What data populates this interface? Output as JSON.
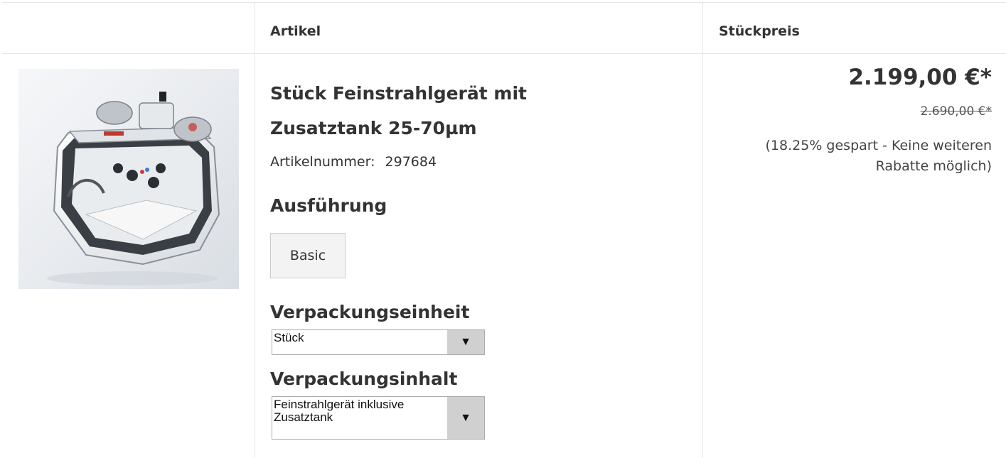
{
  "table": {
    "headers": {
      "image": "",
      "article": "Artikel",
      "unit_price": "Stückpreis"
    }
  },
  "product": {
    "title": "Stück Feinstrahlgerät mit Zusatztank 25-70µm",
    "article_number_label": "Artikelnummer:",
    "article_number": "297684",
    "image_icon": "sandblaster-unit-image"
  },
  "options": {
    "variant_heading": "Ausführung",
    "variant_button": "Basic",
    "packaging_unit_heading": "Verpackungseinheit",
    "packaging_unit_value": "Stück",
    "packaging_content_heading": "Verpackungsinhalt",
    "packaging_content_value": "Feinstrahlgerät inklusive Zusatztank",
    "dropdown_arrow": "▼"
  },
  "pricing": {
    "price": "2.199,00 €*",
    "old_price": "2.690,00 €*",
    "savings_text": "(18.25% gespart - Keine weiteren Rabatte möglich)"
  }
}
